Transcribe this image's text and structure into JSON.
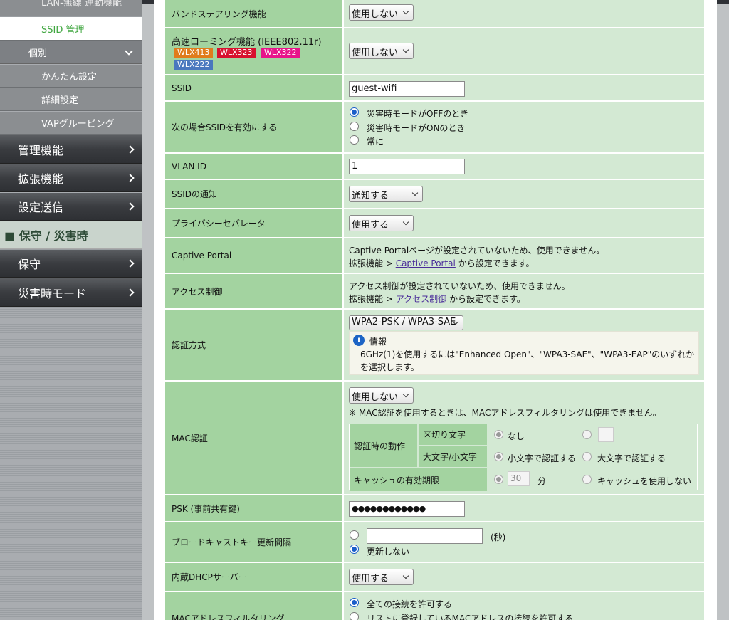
{
  "sidebar": {
    "top_cut": "LAN-無線 連動機能",
    "ssid_mgmt": "SSID 管理",
    "individual": "個別",
    "easy_setup": "かんたん設定",
    "detail_setup": "詳細設定",
    "vap_grouping": "VAPグルーピング",
    "mgmt": "管理機能",
    "ext": "拡張機能",
    "send": "設定送信",
    "current": "■ 保守 / 災害時",
    "maint": "保守",
    "disaster": "災害時モード"
  },
  "form": {
    "band_steering": {
      "label": "バンドステアリング機能",
      "value": "使用しない"
    },
    "fast_roaming": {
      "label": "高速ローミング機能 (IEEE802.11r)",
      "value": "使用しない",
      "badges": [
        {
          "text": "WLX413",
          "color": "#e07b1c"
        },
        {
          "text": "WLX323",
          "color": "#d8102e"
        },
        {
          "text": "WLX322",
          "color": "#e8138a"
        },
        {
          "text": "WLX222",
          "color": "#4a78be"
        }
      ]
    },
    "ssid": {
      "label": "SSID",
      "value": "guest-wifi"
    },
    "enable_when": {
      "label": "次の場合SSIDを有効にする",
      "options": [
        "災害時モードがOFFのとき",
        "災害時モードがONのとき",
        "常に"
      ],
      "selected": 0
    },
    "vlan": {
      "label": "VLAN ID",
      "value": "1"
    },
    "ssid_notify": {
      "label": "SSIDの通知",
      "value": "通知する"
    },
    "privacy": {
      "label": "プライバシーセパレータ",
      "value": "使用する"
    },
    "captive": {
      "label": "Captive Portal",
      "line1": "Captive Portalページが設定されていないため、使用できません。",
      "prefix": "拡張機能 >",
      "link": "Captive Portal",
      "suffix": "から設定できます。"
    },
    "access": {
      "label": "アクセス制御",
      "line1": "アクセス制御が設定されていないため、使用できません。",
      "prefix": "拡張機能 >",
      "link": "アクセス制御",
      "suffix": "から設定できます。"
    },
    "auth": {
      "label": "認証方式",
      "value": "WPA2-PSK / WPA3-SAE",
      "info_title": "情報",
      "info_line1": "6GHz(1)を使用するには\"Enhanced Open\"、\"WPA3-SAE\"、\"WPA3-EAP\"のいずれか",
      "info_line2": "を選択します。"
    },
    "mac_auth": {
      "label": "MAC認証",
      "value": "使用しない",
      "note": "※ MAC認証を使用するときは、MACアドレスフィルタリングは使用できません。",
      "action_label": "認証時の動作",
      "delim_label": "区切り文字",
      "delim_none": "なし",
      "case_label": "大文字/小文字",
      "case_lower": "小文字で認証する",
      "case_upper": "大文字で認証する",
      "cache_label": "キャッシュの有効期限",
      "cache_value": "30",
      "cache_unit": "分",
      "cache_none": "キャッシュを使用しない"
    },
    "psk": {
      "label": "PSK (事前共有鍵)",
      "value": "●●●●●●●●●●●●"
    },
    "bcast": {
      "label": "ブロードキャストキー更新間隔",
      "unit": "(秒)",
      "no_update": "更新しない"
    },
    "dhcp": {
      "label": "内蔵DHCPサーバー",
      "value": "使用する"
    },
    "macfilter": {
      "label": "MACアドレスフィルタリング",
      "opt1": "全ての接続を許可する",
      "opt2": "リストに登録しているMACアドレスの接続を許可する"
    }
  }
}
